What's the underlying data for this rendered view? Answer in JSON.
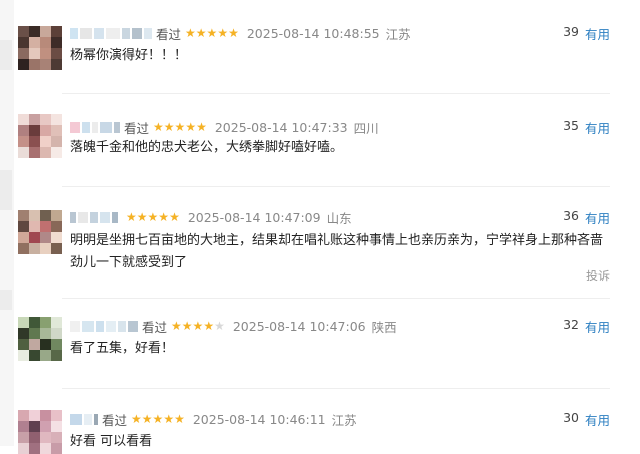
{
  "comments": [
    {
      "user_status": "看过",
      "rating": 5,
      "time": "2025-08-14 10:48:55",
      "region": "江苏",
      "votes": "39",
      "useful_label": "有用",
      "text": "杨幂你演得好！！！"
    },
    {
      "user_status": "看过",
      "rating": 5,
      "time": "2025-08-14 10:47:33",
      "region": "四川",
      "votes": "35",
      "useful_label": "有用",
      "text": "落魄千金和他的忠犬老公，大绣拳脚好嗑好嗑。"
    },
    {
      "user_status": "",
      "rating": 5,
      "time": "2025-08-14 10:47:09",
      "region": "山东",
      "votes": "36",
      "useful_label": "有用",
      "text": "明明是坐拥七百亩地的大地主，结果却在唱礼账这种事情上也亲历亲为，宁学祥身上那种吝啬劲儿一下就感受到了",
      "report_label": "投诉"
    },
    {
      "user_status": "看过",
      "rating": 4,
      "time": "2025-08-14 10:47:06",
      "region": "陕西",
      "votes": "32",
      "useful_label": "有用",
      "text": "看了五集，好看！"
    },
    {
      "user_status": "看过",
      "rating": 5,
      "time": "2025-08-14 10:46:11",
      "region": "江苏",
      "votes": "30",
      "useful_label": "有用",
      "text": "好看 可以看看"
    }
  ],
  "colors": {
    "star": "#f5b225",
    "star_off": "#d8d8d8",
    "link": "#2d7fc1",
    "meta": "#888888"
  }
}
